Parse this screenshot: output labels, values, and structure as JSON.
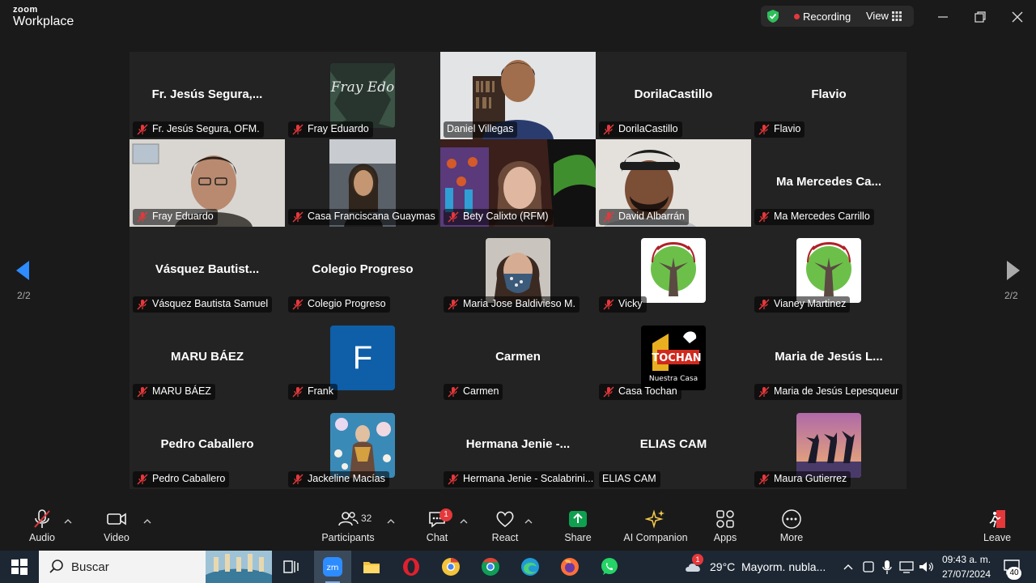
{
  "app": {
    "brand_top": "zoom",
    "brand_bottom": "Workplace"
  },
  "titlebar": {
    "recording_label": "Recording",
    "view_label": "View"
  },
  "pager": {
    "left_count": "2/2",
    "right_count": "2/2"
  },
  "participants": [
    {
      "display": "Fr. Jesús Segura,...",
      "label": "Fr. Jesús Segura, OFM.",
      "kind": "name"
    },
    {
      "display": "",
      "label": "Fray Eduardo",
      "kind": "image",
      "image_text": "Fray Edo"
    },
    {
      "display": "",
      "label": "Daniel Villegas",
      "kind": "video",
      "active": true
    },
    {
      "display": "DorilaCastillo",
      "label": "DorilaCastillo",
      "kind": "name"
    },
    {
      "display": "Flavio",
      "label": "Flavio",
      "kind": "name"
    },
    {
      "display": "",
      "label": "Fray Eduardo",
      "kind": "video"
    },
    {
      "display": "",
      "label": "Casa Franciscana Guaymas",
      "kind": "video"
    },
    {
      "display": "",
      "label": "Bety Calixto (RFM)",
      "kind": "video"
    },
    {
      "display": "",
      "label": "David Albarrán",
      "kind": "video"
    },
    {
      "display": "Ma Mercedes Ca...",
      "label": "Ma Mercedes Carrillo",
      "kind": "name"
    },
    {
      "display": "Vásquez Bautist...",
      "label": "Vásquez Bautista Samuel",
      "kind": "name"
    },
    {
      "display": "Colegio Progreso",
      "label": "Colegio Progreso",
      "kind": "name"
    },
    {
      "display": "",
      "label": "Maria Jose Baldivieso M.",
      "kind": "image"
    },
    {
      "display": "",
      "label": "Vicky",
      "kind": "image"
    },
    {
      "display": "",
      "label": "Vianey Martinez",
      "kind": "image"
    },
    {
      "display": "MARU BÁEZ",
      "label": "MARU BÁEZ",
      "kind": "name"
    },
    {
      "display": "",
      "label": "Frank",
      "kind": "initial",
      "initial": "F"
    },
    {
      "display": "Carmen",
      "label": "Carmen",
      "kind": "name"
    },
    {
      "display": "",
      "label": "Casa Tochan",
      "kind": "image",
      "image_text": "Nuestra Casa",
      "image_text2": "TOCHAN"
    },
    {
      "display": "Maria de Jesús L...",
      "label": "Maria de Jesús Lepesqueur",
      "kind": "name"
    },
    {
      "display": "Pedro Caballero",
      "label": "Pedro Caballero",
      "kind": "name"
    },
    {
      "display": "",
      "label": "Jackeline Macías",
      "kind": "image"
    },
    {
      "display": "Hermana Jenie -...",
      "label": "Hermana Jenie - Scalabrini...",
      "kind": "name"
    },
    {
      "display": "ELIAS CAM",
      "label": "ELIAS CAM",
      "kind": "name"
    },
    {
      "display": "",
      "label": "Maura Gutierrez",
      "kind": "image"
    }
  ],
  "toolbar": {
    "audio": "Audio",
    "video": "Video",
    "participants": "Participants",
    "participants_count": "32",
    "chat": "Chat",
    "chat_badge": "1",
    "react": "React",
    "share": "Share",
    "ai": "AI Companion",
    "apps": "Apps",
    "more": "More",
    "leave": "Leave"
  },
  "taskbar": {
    "search_placeholder": "Buscar",
    "weather_temp": "29°C",
    "weather_text": "Mayorm. nubla...",
    "weather_badge": "1",
    "time": "09:43 a. m.",
    "date": "27/07/2024",
    "notif_count": "40"
  },
  "colors": {
    "active_border": "#3ddc84",
    "record_red": "#e5383b",
    "share_green": "#0e9f4f",
    "leave_red": "#e5383b"
  }
}
